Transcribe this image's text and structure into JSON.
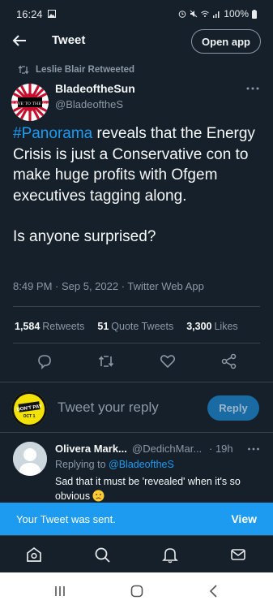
{
  "status_bar": {
    "time": "16:24",
    "battery": "100%"
  },
  "header": {
    "title": "Tweet",
    "open_app": "Open app"
  },
  "retweet": {
    "label": "Leslie Blair Retweeted"
  },
  "author": {
    "name": "BladeoftheSun",
    "handle": "@BladeoftheS",
    "avatar_text": "SLAVE TO THE Sun"
  },
  "tweet": {
    "hashtag": "#Panorama",
    "text_rest": " reveals that the Energy Crisis is just a Conservative con to make huge profits with Ofgem executives tagging along.",
    "text_second": "Is anyone surprised?",
    "meta": "8:49 PM · Sep 5, 2022 · Twitter Web App"
  },
  "stats": {
    "retweets_count": "1,584",
    "retweets_label": "Retweets",
    "quotes_count": "51",
    "quotes_label": "Quote Tweets",
    "likes_count": "3,300",
    "likes_label": "Likes"
  },
  "reply_box": {
    "placeholder": "Tweet your reply",
    "button": "Reply",
    "avatar_line1": "DON'T PAY",
    "avatar_line2": "OCT 1"
  },
  "comment": {
    "name": "Olivera Mark...",
    "handle": "@DedichMar...",
    "time": "· 19h",
    "replying_prefix": "Replying to ",
    "replying_to": "@BladeoftheS",
    "text": "Sad that it must be 'revealed' when it's so obvious"
  },
  "toast": {
    "message": "Your Tweet was sent.",
    "action": "View"
  },
  "colors": {
    "background": "#15202b",
    "accent": "#1d9bf0",
    "muted": "#8b98a5"
  }
}
